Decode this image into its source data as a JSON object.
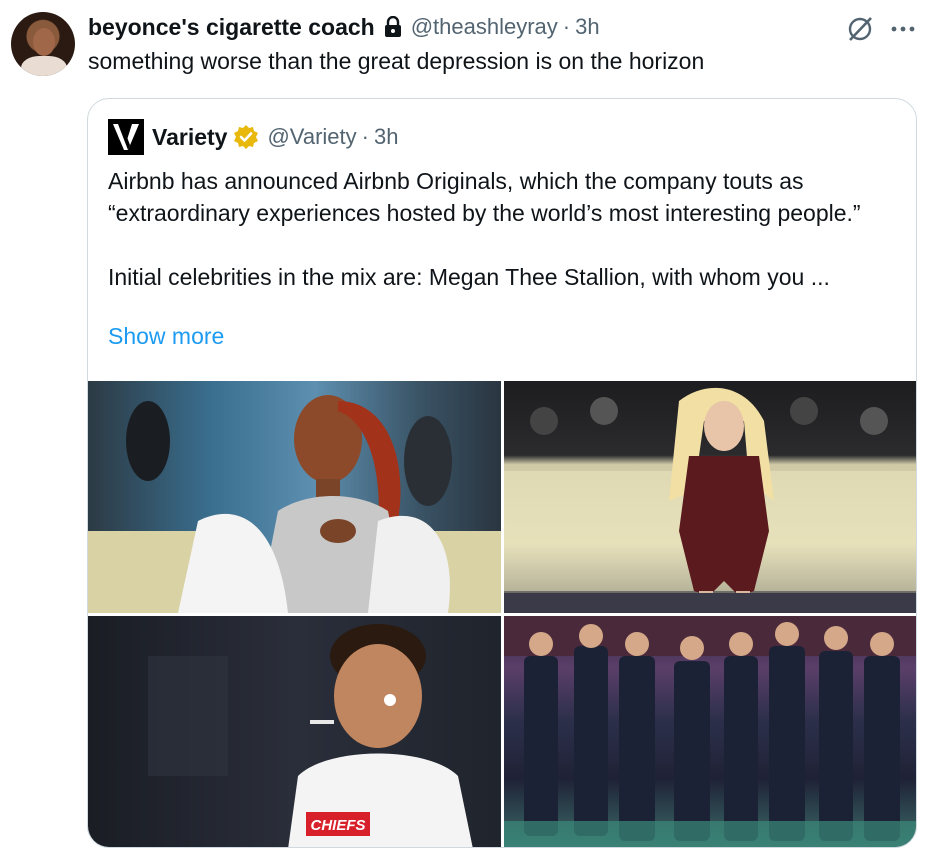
{
  "author": {
    "display_name": "beyonce's cigarette coach",
    "handle": "@theashleyray",
    "separator": "·",
    "time": "3h"
  },
  "tweet": {
    "text": "something worse than the great depression is on the horizon"
  },
  "quoted": {
    "name": "Variety",
    "handle": "@Variety",
    "separator": "·",
    "time": "3h",
    "paragraph1": "Airbnb has announced Airbnb Originals, which the company touts as “extraordinary experiences hosted by the world’s most interesting people.”",
    "paragraph2": "Initial celebrities in the mix are: Megan Thee Stallion, with whom you ...",
    "show_more": "Show more",
    "photos": [
      {
        "icon": "photo-megan"
      },
      {
        "icon": "photo-sabrina"
      },
      {
        "icon": "photo-mahomes",
        "jersey_text": "CHIEFS"
      },
      {
        "icon": "photo-kpop-group"
      }
    ]
  },
  "colors": {
    "text": "#0f1419",
    "secondary": "#536471",
    "link": "#1d9bf0",
    "border": "#cfd9de",
    "verified": "#e8b90c"
  },
  "icons": [
    "lock-icon",
    "grok-icon",
    "more-icon",
    "variety-logo-icon",
    "verified-badge-icon"
  ]
}
